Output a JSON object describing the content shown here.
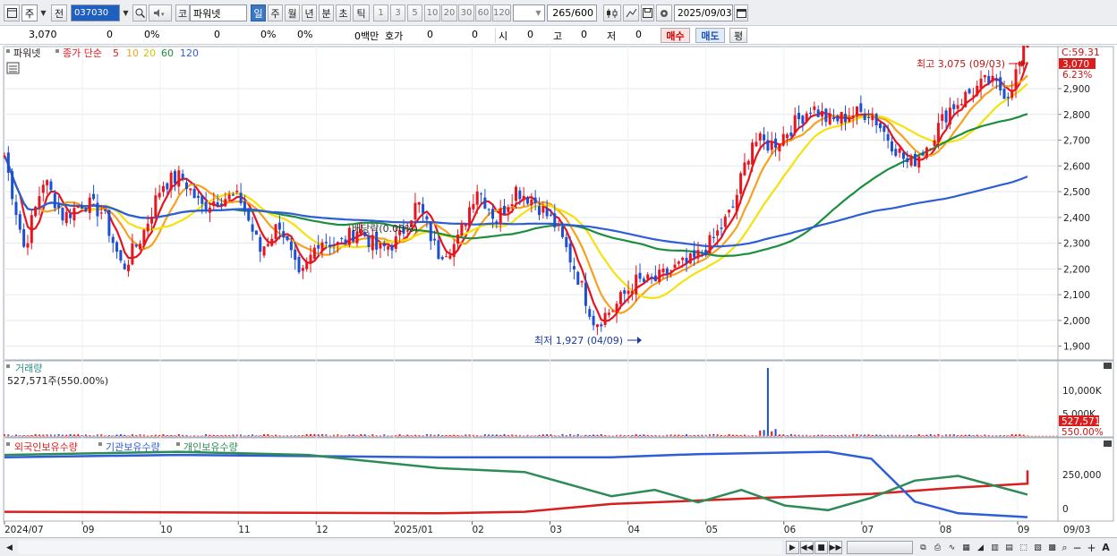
{
  "toolbar": {
    "period_label": "주",
    "prev_label": "전",
    "code_value": "037030",
    "market_label": "코",
    "stock_name": "파워넷",
    "tabs": [
      "일",
      "주",
      "월",
      "년",
      "분",
      "초",
      "틱"
    ],
    "active_tab": "일",
    "intervals": [
      "1",
      "3",
      "5",
      "10",
      "20",
      "30",
      "60",
      "120"
    ],
    "count_value": "265",
    "count_total": "/600",
    "date_value": "2025/09/03"
  },
  "info": {
    "price": "3,070",
    "change": "0",
    "change_pct": "0%",
    "volume": "0",
    "vol_pct": "0%",
    "pct3": "0%",
    "amount": "0백만",
    "quote_label": "호가",
    "q1": "0",
    "q2": "0",
    "open_label": "시",
    "open_val": "0",
    "high_label": "고",
    "high_val": "0",
    "low_label": "저",
    "low_val": "0",
    "buy_label": "매수",
    "sell_label": "매도",
    "eval_label": "평"
  },
  "price_panel": {
    "stock_tag": "파워넷",
    "legend_close": "종가 단순",
    "ma_labels": [
      "5",
      "10",
      "20",
      "60",
      "120"
    ],
    "ma_colors": [
      "#e8141e",
      "#f7a120",
      "#f5e20c",
      "#1e8e3e",
      "#2e5ed6"
    ],
    "c_label": "C:59.31",
    "last_price": "3,070",
    "last_change": "6.23%",
    "high_annotation": "최고 3,075 (09/03)",
    "low_annotation": "최저 1,927 (04/09)",
    "dividend_label": "배당락(0.00%)",
    "y_ticks": [
      "2,900",
      "2,800",
      "2,700",
      "2,600",
      "2,500",
      "2,400",
      "2,300",
      "2,200",
      "2,100",
      "2,000",
      "1,900"
    ]
  },
  "volume_panel": {
    "title": "거래량",
    "value_label": "527,571주(550.00%)",
    "y_ticks": [
      "10,000K",
      "5,000K"
    ],
    "last_value": "527,571",
    "last_pct": "550.00%"
  },
  "holding_panel": {
    "legend": [
      "외국인보유수량",
      "기관보유수량",
      "개인보유수량"
    ],
    "legend_colors": [
      "#d81e1e",
      "#2e5ed6",
      "#2e8b57"
    ],
    "y_ticks": [
      "250,000",
      "0"
    ]
  },
  "x_axis": {
    "labels": [
      "2024/07",
      "09",
      "10",
      "11",
      "12",
      "2025/01",
      "02",
      "03",
      "04",
      "05",
      "06",
      "07",
      "08",
      "09"
    ],
    "last_label": "09/03"
  },
  "chart_data": {
    "type": "candlestick",
    "title": "파워넷",
    "price_high": 3075,
    "price_low": 1927,
    "ylim": [
      1850,
      3060
    ],
    "moving_averages": [
      "5",
      "10",
      "20",
      "60",
      "120"
    ],
    "close_path": [
      2640,
      2280,
      2550,
      2400,
      2460,
      2420,
      2200,
      2330,
      2530,
      2560,
      2440,
      2480,
      2470,
      2270,
      2380,
      2150,
      2320,
      2290,
      2360,
      2270,
      2310,
      2460,
      2260,
      2300,
      2520,
      2390,
      2510,
      2460,
      2370,
      2200,
      1990,
      2050,
      2150,
      2150,
      2200,
      2230,
      2310,
      2430,
      2700,
      2680,
      2750,
      2830,
      2770,
      2800,
      2810,
      2700,
      2600,
      2690,
      2820,
      2880,
      2930,
      2880,
      3075
    ],
    "volume": {
      "spike_month": "06",
      "last": 527571,
      "last_pct": 550.0
    }
  }
}
